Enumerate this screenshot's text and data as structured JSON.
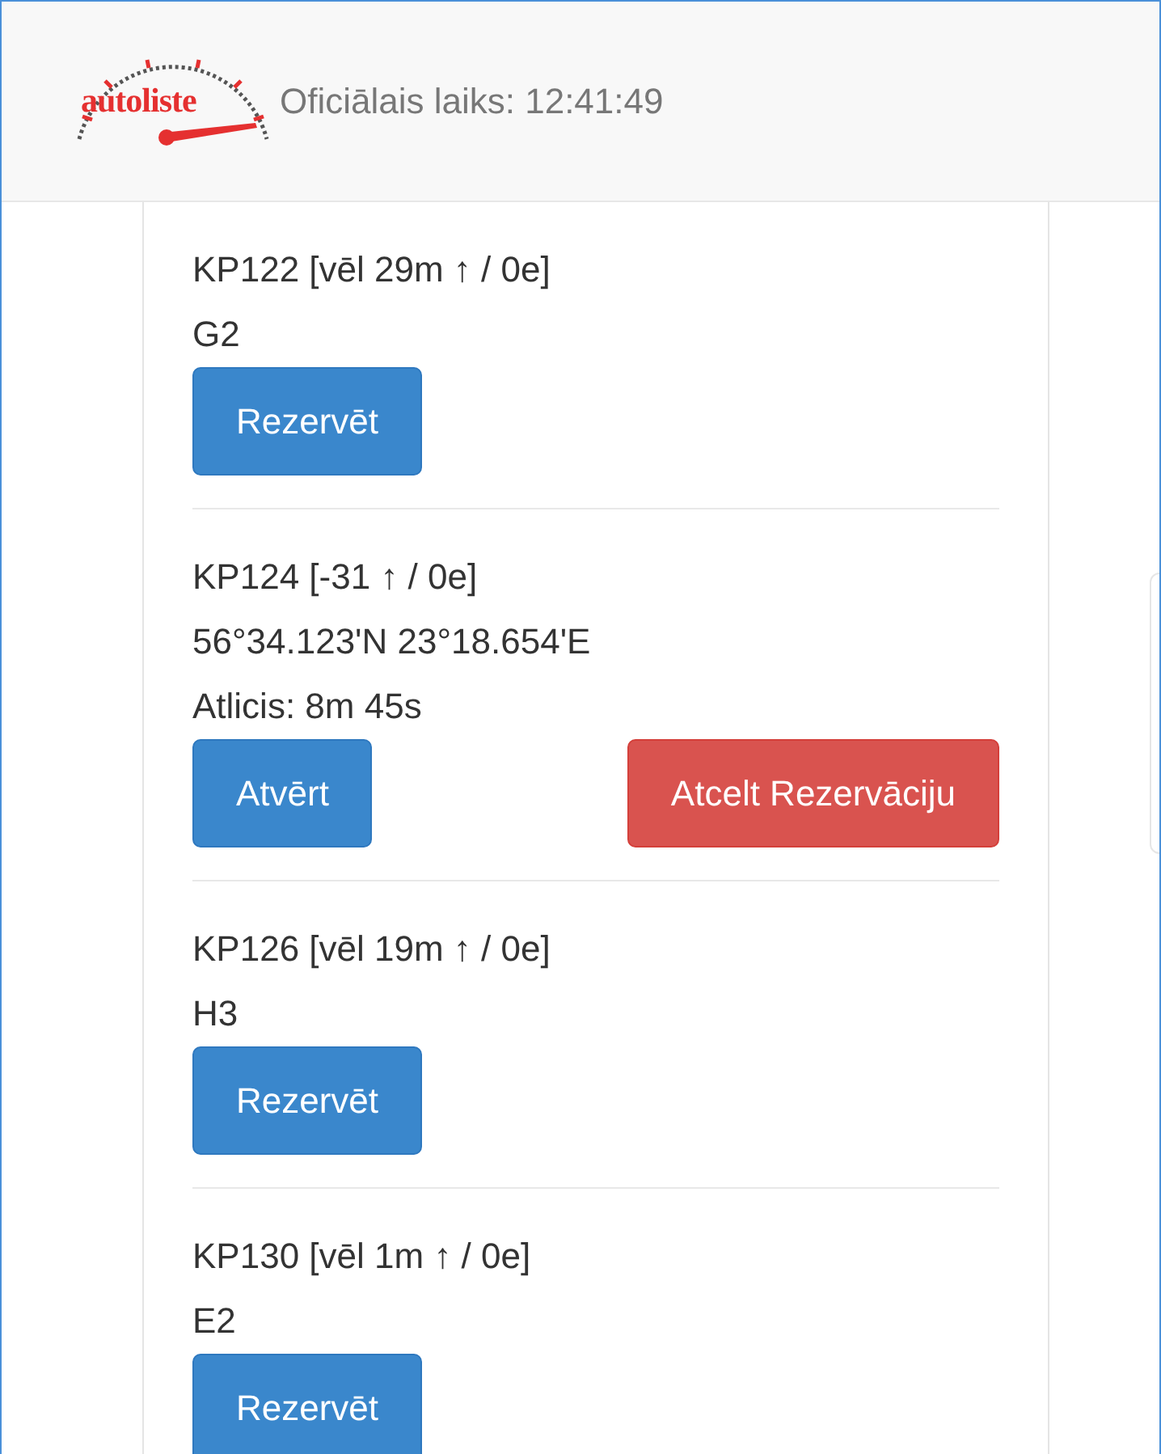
{
  "header": {
    "logo": "autoliste",
    "official_time": "Oficiālais laiks: 12:41:49"
  },
  "checkpoints": [
    {
      "title": "KP122 [vēl 29m ↑ / 0e]",
      "lines": [
        "G2"
      ],
      "buttons": [
        {
          "label": "Rezervēt",
          "kind": "primary"
        }
      ]
    },
    {
      "title": "KP124 [-31 ↑ / 0e]",
      "lines": [
        "56°34.123'N 23°18.654'E",
        "Atlicis: 8m 45s"
      ],
      "buttons": [
        {
          "label": "Atvērt",
          "kind": "primary"
        },
        {
          "label": "Atcelt Rezervāciju",
          "kind": "danger"
        }
      ]
    },
    {
      "title": "KP126 [vēl 19m ↑ / 0e]",
      "lines": [
        "H3"
      ],
      "buttons": [
        {
          "label": "Rezervēt",
          "kind": "primary"
        }
      ]
    },
    {
      "title": "KP130 [vēl 1m ↑ / 0e]",
      "lines": [
        "E2"
      ],
      "buttons": [
        {
          "label": "Rezervēt",
          "kind": "primary"
        }
      ]
    }
  ]
}
